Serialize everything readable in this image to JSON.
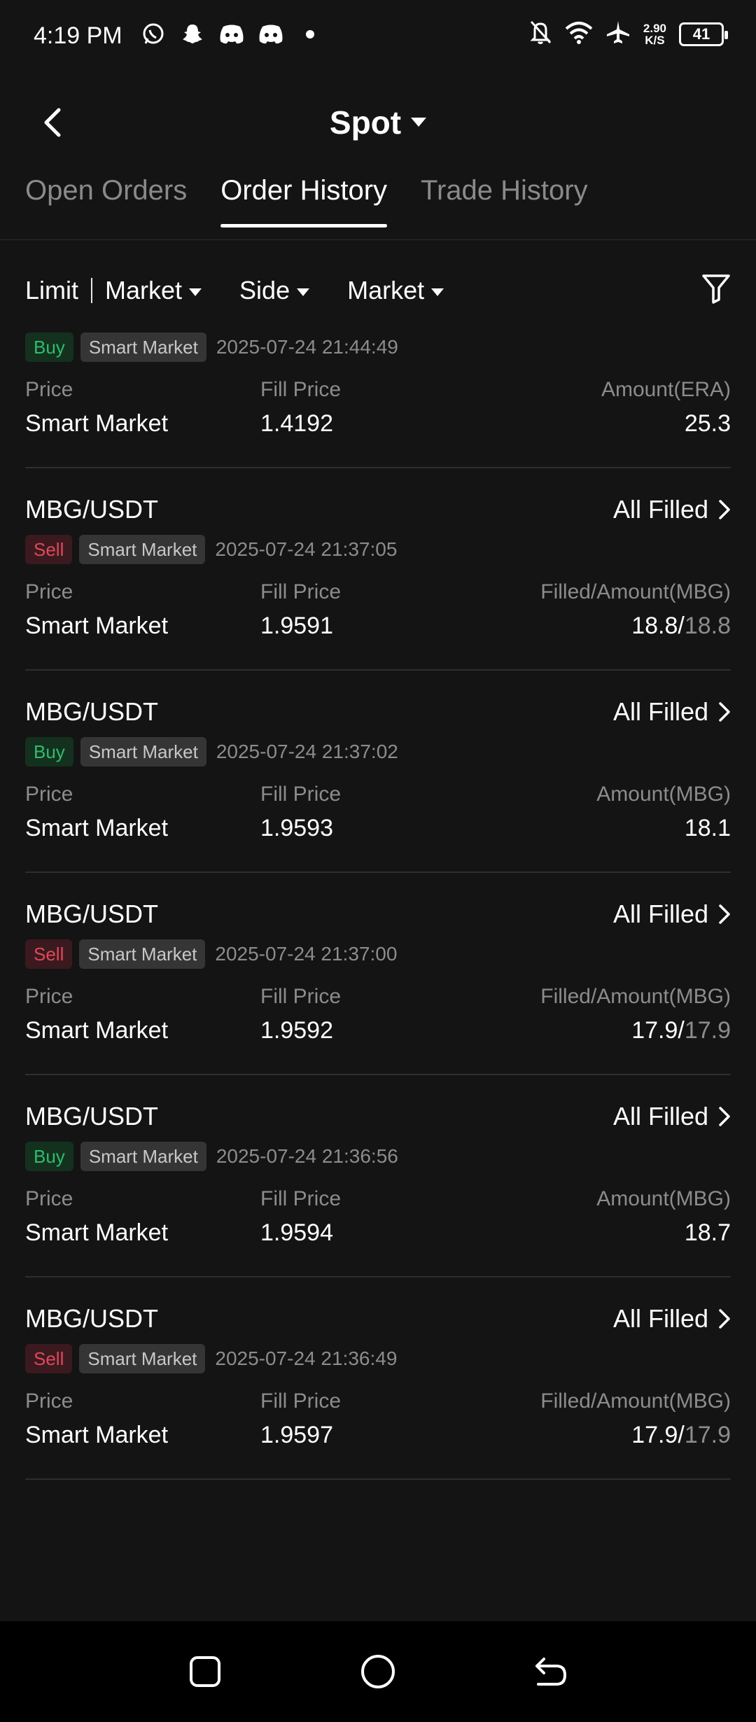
{
  "status_bar": {
    "time": "4:19 PM",
    "net_rate_value": "2.90",
    "net_rate_unit": "K/S",
    "battery": "41",
    "icons": [
      "whatsapp-icon",
      "snapchat-icon",
      "discord-icon",
      "discord-icon",
      "dot-icon",
      "bell-off-icon",
      "wifi-icon",
      "airplane-icon"
    ]
  },
  "header": {
    "title": "Spot"
  },
  "tabs": [
    {
      "label": "Open Orders",
      "active": false
    },
    {
      "label": "Order History",
      "active": true
    },
    {
      "label": "Trade History",
      "active": false
    }
  ],
  "filters": {
    "limit": "Limit",
    "market_type": "Market",
    "side": "Side",
    "market": "Market"
  },
  "colors": {
    "buy": "#2fbd6c",
    "sell": "#e0485b",
    "background": "#141414"
  },
  "orders": [
    {
      "pair": "",
      "status": "",
      "side": "Buy",
      "type": "Smart Market",
      "time": "2025-07-24 21:44:49",
      "price_label": "Price",
      "fill_label": "Fill Price",
      "amount_label": "Amount(ERA)",
      "price": "Smart Market",
      "fill_price": "1.4192",
      "amount": "25.3",
      "amount_total": ""
    },
    {
      "pair": "MBG/USDT",
      "status": "All Filled",
      "side": "Sell",
      "type": "Smart Market",
      "time": "2025-07-24 21:37:05",
      "price_label": "Price",
      "fill_label": "Fill Price",
      "amount_label": "Filled/Amount(MBG)",
      "price": "Smart Market",
      "fill_price": "1.9591",
      "amount": "18.8/",
      "amount_total": "18.8"
    },
    {
      "pair": "MBG/USDT",
      "status": "All Filled",
      "side": "Buy",
      "type": "Smart Market",
      "time": "2025-07-24 21:37:02",
      "price_label": "Price",
      "fill_label": "Fill Price",
      "amount_label": "Amount(MBG)",
      "price": "Smart Market",
      "fill_price": "1.9593",
      "amount": "18.1",
      "amount_total": ""
    },
    {
      "pair": "MBG/USDT",
      "status": "All Filled",
      "side": "Sell",
      "type": "Smart Market",
      "time": "2025-07-24 21:37:00",
      "price_label": "Price",
      "fill_label": "Fill Price",
      "amount_label": "Filled/Amount(MBG)",
      "price": "Smart Market",
      "fill_price": "1.9592",
      "amount": "17.9/",
      "amount_total": "17.9"
    },
    {
      "pair": "MBG/USDT",
      "status": "All Filled",
      "side": "Buy",
      "type": "Smart Market",
      "time": "2025-07-24 21:36:56",
      "price_label": "Price",
      "fill_label": "Fill Price",
      "amount_label": "Amount(MBG)",
      "price": "Smart Market",
      "fill_price": "1.9594",
      "amount": "18.7",
      "amount_total": ""
    },
    {
      "pair": "MBG/USDT",
      "status": "All Filled",
      "side": "Sell",
      "type": "Smart Market",
      "time": "2025-07-24 21:36:49",
      "price_label": "Price",
      "fill_label": "Fill Price",
      "amount_label": "Filled/Amount(MBG)",
      "price": "Smart Market",
      "fill_price": "1.9597",
      "amount": "17.9/",
      "amount_total": "17.9"
    }
  ],
  "nav": [
    "recents-button",
    "home-button",
    "back-button"
  ]
}
